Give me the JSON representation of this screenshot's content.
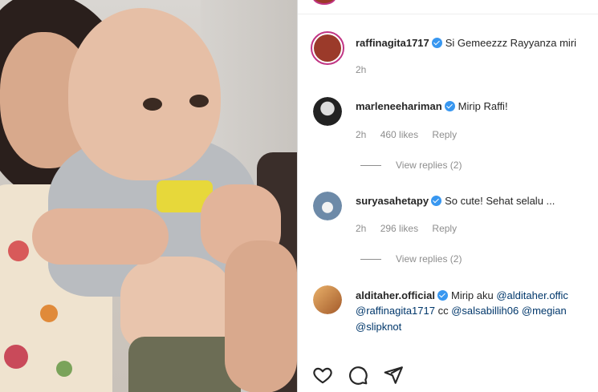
{
  "post": {
    "caption": {
      "username": "raffinagita1717",
      "text": "Si Gemeezzz Rayyanza miri",
      "time": "2h",
      "avatar_color": "#9b3a2a"
    }
  },
  "comments": [
    {
      "username": "marleneehariman",
      "text": "Mirip Raffi!",
      "time": "2h",
      "likes": "460 likes",
      "reply": "Reply",
      "view_replies": "View replies (2)",
      "avatar_color": "#2b2b2b"
    },
    {
      "username": "suryasahetapy",
      "text": "So cute! Sehat selalu ...",
      "time": "2h",
      "likes": "296 likes",
      "reply": "Reply",
      "view_replies": "View replies (2)",
      "avatar_color": "#6d8aa8"
    },
    {
      "username": "alditaher.official",
      "line1_prefix": "Mirip aku",
      "line1_mention": "@alditaher.offic",
      "line2_mention1": "@raffinagita1717",
      "line2_text": "cc",
      "line2_mention2": "@salsabillih06",
      "line2_mention3": "@megian",
      "line3_mention": "@slipknot",
      "avatar_color": "#c98a4a"
    }
  ],
  "actions": [
    "heart-icon",
    "comment-icon",
    "share-icon"
  ],
  "colors": {
    "verified": "#3897f0",
    "mention": "#00376b",
    "meta": "#8e8e8e",
    "story_ring": "#c13584"
  }
}
